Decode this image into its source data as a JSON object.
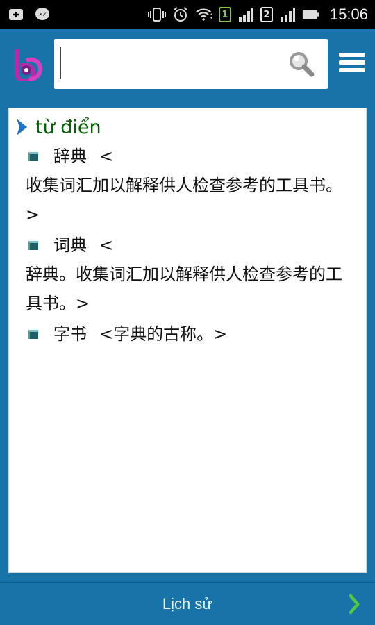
{
  "status_bar": {
    "time": "15:06",
    "sim1_label": "1",
    "sim2_label": "2"
  },
  "search": {
    "value": "",
    "placeholder": ""
  },
  "result": {
    "headword": "từ điển",
    "entries": [
      {
        "word": "辞典",
        "open": "<",
        "definition": "收集词汇加以解释供人检查参考的工具书。>"
      },
      {
        "word": "词典",
        "open": "<",
        "definition": "辞典。收集词汇加以解释供人检查参考的工具书。>"
      },
      {
        "word": "字书",
        "inline": "<字典的古称。>"
      }
    ]
  },
  "bottom_bar": {
    "history_label": "Lịch sử"
  },
  "colors": {
    "app_blue": "#1874a8",
    "headword_green": "#006400",
    "chevron_blue": "#1e73c8",
    "next_green": "#55c83c"
  }
}
